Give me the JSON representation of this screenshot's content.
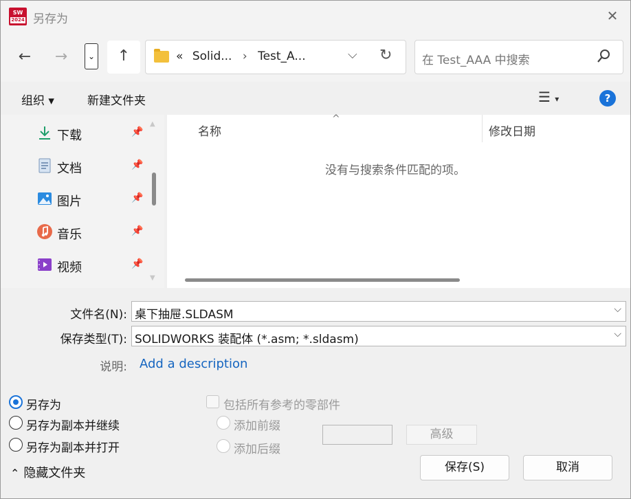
{
  "window": {
    "title": "另存为",
    "app_logo_text": "SW",
    "app_logo_year": "2024"
  },
  "nav": {
    "address_prefix": "«",
    "address_segments": [
      "Solid...",
      "Test_A..."
    ],
    "address_separator": "›",
    "search_placeholder": "在 Test_AAA 中搜索"
  },
  "toolbar": {
    "organize": "组织 ▾",
    "new_folder": "新建文件夹",
    "help": "?"
  },
  "sidebar": {
    "items": [
      {
        "label": "下载",
        "icon": "download-icon"
      },
      {
        "label": "文档",
        "icon": "document-icon"
      },
      {
        "label": "图片",
        "icon": "pictures-icon"
      },
      {
        "label": "音乐",
        "icon": "music-icon"
      },
      {
        "label": "视频",
        "icon": "video-icon"
      }
    ]
  },
  "filelist": {
    "columns": [
      "名称",
      "修改日期"
    ],
    "empty_message": "没有与搜索条件匹配的项。"
  },
  "form": {
    "filename_label": "文件名(N):",
    "filename_value": "桌下抽屉.SLDASM",
    "filetype_label": "保存类型(T):",
    "filetype_value": "SOLIDWORKS 装配体 (*.asm; *.sldasm)",
    "description_label": "说明:",
    "description_link": "Add a description"
  },
  "options": {
    "save_as": "另存为",
    "save_copy_continue": "另存为副本并继续",
    "save_copy_open": "另存为副本并打开",
    "include_refs": "包括所有参考的零部件",
    "add_prefix": "添加前缀",
    "add_suffix": "添加后缀",
    "advanced": "高级",
    "selected": "save_as"
  },
  "buttons": {
    "save": "保存(S)",
    "cancel": "取消",
    "hide_folders": "隐藏文件夹"
  },
  "colors": {
    "accent": "#1a73d9",
    "link": "#1565c0",
    "logo": "#c8102e"
  }
}
